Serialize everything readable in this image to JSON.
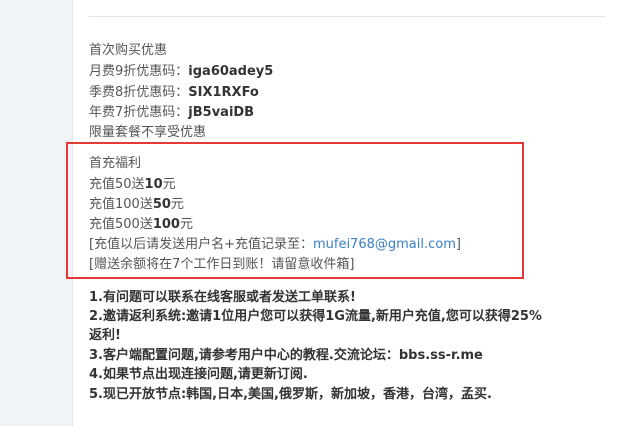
{
  "first_purchase": {
    "title": "首次购买优惠",
    "monthly_label": "月费9折优惠码：",
    "monthly_code": "iga60adey5",
    "quarterly_label": "季费8折优惠码：",
    "quarterly_code": "SIX1RXFo",
    "yearly_label": "年费7折优惠码：",
    "yearly_code": "jB5vaiDB",
    "note": "限量套餐不享受优惠"
  },
  "recharge": {
    "title": "首充福利",
    "r1_prefix": "充值50送",
    "r1_bonus": "10",
    "r2_prefix": "充值100送",
    "r2_bonus": "50",
    "r3_prefix": "充值500送",
    "r3_bonus": "100",
    "unit": "元",
    "contact_prefix": "[充值以后请发送用户名+充值记录至：",
    "contact_email": "mufei768@gmail.com",
    "contact_suffix": "]",
    "arrival_note": "[赠送余额将在7个工作日到账！请留意收件箱]"
  },
  "notices": {
    "n1": "1.有问题可以联系在线客服或者发送工单联系!",
    "n2a": "2.邀请返利系统:邀请1位用户您可以获得1G流量,新用户充值,您可以获得25%",
    "n2b": "返利!",
    "n3": "3.客户端配置问题,请参考用户中心的教程.交流论坛：bbs.ss-r.me",
    "n4": "4.如果节点出现连接问题,请更新订阅.",
    "n5": "5.现已开放节点:韩国,日本,美国,俄罗斯，新加坡，香港，台湾，孟买."
  }
}
